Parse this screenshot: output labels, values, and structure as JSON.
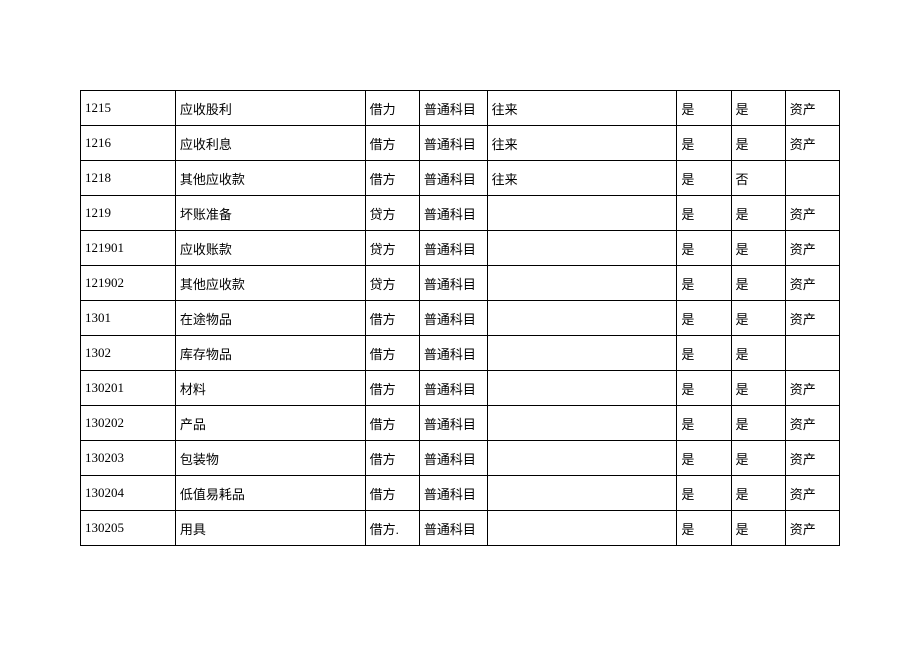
{
  "table": {
    "rows": [
      {
        "code": "1215",
        "name": "应收股利",
        "dir": "借力",
        "type": "普通科目",
        "aux": "往来",
        "f1": "是",
        "f2": "是",
        "cat": "资产"
      },
      {
        "code": "1216",
        "name": "应收利息",
        "dir": "借方",
        "type": "普通科目",
        "aux": "往来",
        "f1": "是",
        "f2": "是",
        "cat": "资产"
      },
      {
        "code": "1218",
        "name": "其他应收款",
        "dir": "借方",
        "type": "普通科目",
        "aux": "往来",
        "f1": "是",
        "f2": "否",
        "cat": ""
      },
      {
        "code": "1219",
        "name": "坏账准备",
        "dir": "贷方",
        "type": "普通科目",
        "aux": "",
        "f1": "是",
        "f2": "是",
        "cat": "资产"
      },
      {
        "code": "121901",
        "name": "应收账款",
        "dir": "贷方",
        "type": "普通科目",
        "aux": "",
        "f1": "是",
        "f2": "是",
        "cat": "资产"
      },
      {
        "code": "121902",
        "name": "其他应收款",
        "dir": "贷方",
        "type": "普通科目",
        "aux": "",
        "f1": "是",
        "f2": "是",
        "cat": "资产"
      },
      {
        "code": "1301",
        "name": "在途物品",
        "dir": "借方",
        "type": "普通科目",
        "aux": "",
        "f1": "是",
        "f2": "是",
        "cat": "资产"
      },
      {
        "code": "1302",
        "name": "库存物品",
        "dir": "借方",
        "type": "普通科目",
        "aux": "",
        "f1": "是",
        "f2": "是",
        "cat": ""
      },
      {
        "code": "130201",
        "name": "材料",
        "dir": "借方",
        "type": "普通科目",
        "aux": "",
        "f1": "是",
        "f2": "是",
        "cat": "资产"
      },
      {
        "code": "130202",
        "name": "产品",
        "dir": "借方",
        "type": "普通科目",
        "aux": "",
        "f1": "是",
        "f2": "是",
        "cat": "资产"
      },
      {
        "code": "130203",
        "name": "包装物",
        "dir": "借方",
        "type": "普通科目",
        "aux": "",
        "f1": "是",
        "f2": "是",
        "cat": "资产"
      },
      {
        "code": "130204",
        "name": "低值易耗品",
        "dir": "借方",
        "type": "普通科目",
        "aux": "",
        "f1": "是",
        "f2": "是",
        "cat": "资产"
      },
      {
        "code": "130205",
        "name": "用具",
        "dir": "借方.",
        "type": "普通科目",
        "aux": "",
        "f1": "是",
        "f2": "是",
        "cat": "资产"
      }
    ]
  }
}
